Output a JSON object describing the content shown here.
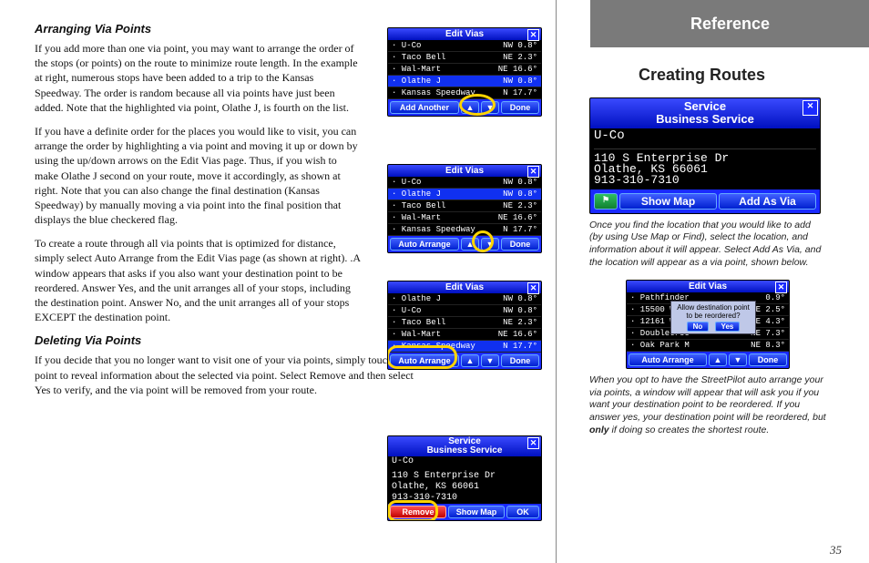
{
  "ref_tab": "Reference",
  "right_heading": "Creating Routes",
  "page_number": "35",
  "h_arranging": "Arranging Via Points",
  "p1": "If you add more than one via point, you may want to arrange the order of the stops (or points) on the route to minimize route length. In the example at right, numerous stops have been added to a trip to the Kansas Speedway. The order is random because all via points have just been added. Note that the highlighted via point, Olathe J, is fourth on the list.",
  "p2": "If you have a definite order for the places you would like to visit, you can arrange the order by highlighting a via point and moving it up or down by using the up/down arrows on the Edit Vias page. Thus, if you wish to make Olathe J second on your route, move it accordingly, as shown at right. Note that you can also change the final destination (Kansas Speedway) by manually moving a via point into the final position that displays the blue checkered flag.",
  "p3": "To create a route through all via points that is optimized for distance, simply select Auto Arrange from the Edit Vias page (as shown at right). .A window appears that asks if you also want your destination point to be reordered. Answer Yes, and the unit arranges all of your stops, including the destination point. Answer No, and the unit arranges all of your stops EXCEPT the destination point.",
  "h_deleting": "Deleting Via Points",
  "p4": "If you decide that you no longer want to visit one of your via points, simply touch that point to reveal information about the selected via point. Select Remove and then select Yes to verify, and the via point will be removed from your route.",
  "cap1": "Once you find the location that you would like to add (by using Use Map or Find), select the location, and information about it will appear. Select Add As Via, and the location will appear as a via point, shown below.",
  "cap2a": "When you opt to have the StreetPilot auto arrange your via points, a window will appear that will ask you if you want your destination point to be reordered. If you answer yes, your destination point will be reordered, but ",
  "cap2b": "only",
  "cap2c": " if doing so creates the shortest route.",
  "edit_vias_title": "Edit Vias",
  "service_title1": "Service",
  "service_title2": "Business Service",
  "btn_add_another": "Add Another",
  "btn_done": "Done",
  "btn_auto_arrange": "Auto Arrange",
  "btn_show_map": "Show Map",
  "btn_add_as_via": "Add As Via",
  "btn_remove": "Remove",
  "btn_ok": "OK",
  "btn_no": "No",
  "btn_yes": "Yes",
  "arrow_up": "▲",
  "arrow_down": "▼",
  "close_x": "✕",
  "dialog_text": "Allow destination point to be reordered?",
  "svc": {
    "name": "U-Co",
    "addr1": "110 S Enterprise Dr",
    "addr2": "Olathe, KS 66061",
    "phone": "913-310-7310"
  },
  "list_a": [
    {
      "n": "U-Co",
      "d": "NW",
      "m": "0.8°"
    },
    {
      "n": "Taco Bell",
      "d": "NE",
      "m": "2.3°"
    },
    {
      "n": "Wal-Mart",
      "d": "NE",
      "m": "16.6°"
    },
    {
      "n": "Olathe J",
      "d": "NW",
      "m": "0.8°",
      "sel": true
    },
    {
      "n": "Kansas Speedway",
      "d": "N",
      "m": "17.7°"
    }
  ],
  "list_b": [
    {
      "n": "U-Co",
      "d": "NW",
      "m": "0.8°"
    },
    {
      "n": "Olathe J",
      "d": "NW",
      "m": "0.8°",
      "sel": true
    },
    {
      "n": "Taco Bell",
      "d": "NE",
      "m": "2.3°"
    },
    {
      "n": "Wal-Mart",
      "d": "NE",
      "m": "16.6°"
    },
    {
      "n": "Kansas Speedway",
      "d": "N",
      "m": "17.7°"
    }
  ],
  "list_c": [
    {
      "n": "Olathe J",
      "d": "NW",
      "m": "0.8°"
    },
    {
      "n": "U-Co",
      "d": "NW",
      "m": "0.8°"
    },
    {
      "n": "Taco Bell",
      "d": "NE",
      "m": "2.3°"
    },
    {
      "n": "Wal-Mart",
      "d": "NE",
      "m": "16.6°"
    },
    {
      "n": "Kansas Speedway",
      "d": "N",
      "m": "17.7°",
      "sel": true
    }
  ],
  "list_d": [
    {
      "n": "Pathfinder",
      "d": "",
      "m": "0.9°"
    },
    {
      "n": "15500 W",
      "d": "NE",
      "m": "2.5°"
    },
    {
      "n": "12161 W",
      "d": "NE",
      "m": "4.3°"
    },
    {
      "n": "Doubletree",
      "d": "NE",
      "m": "7.3°"
    },
    {
      "n": "Oak Park M",
      "d": "NE",
      "m": "8.3°"
    }
  ]
}
